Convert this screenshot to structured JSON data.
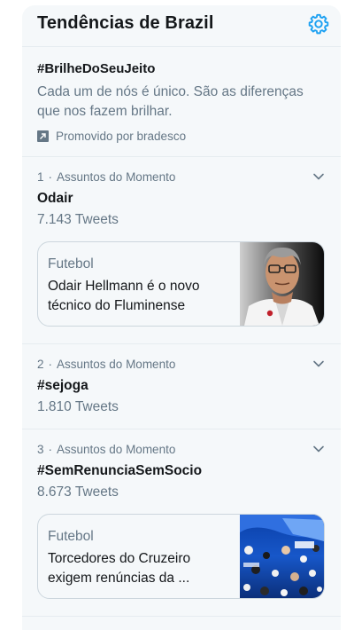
{
  "header": {
    "title": "Tendências de Brazil",
    "settings_icon": "gear-icon",
    "accent": "#1da1f2"
  },
  "promo": {
    "hashtag": "#BrilheDoSeuJeito",
    "description": "Cada um de nós é único. São as diferenças que nos fazem brilhar.",
    "promoted_by": "Promovido por bradesco",
    "icon": "promoted-arrow-icon"
  },
  "trends": [
    {
      "rank": "1",
      "separator": "·",
      "context": "Assuntos do Momento",
      "name": "Odair",
      "count": "7.143 Tweets",
      "card": {
        "category": "Futebol",
        "headline": "Odair Hellmann é o novo técnico do Fluminense"
      }
    },
    {
      "rank": "2",
      "separator": "·",
      "context": "Assuntos do Momento",
      "name": "#sejoga",
      "count": "1.810 Tweets"
    },
    {
      "rank": "3",
      "separator": "·",
      "context": "Assuntos do Momento",
      "name": "#SemRenunciaSemSocio",
      "count": "8.673 Tweets",
      "card": {
        "category": "Futebol",
        "headline": "Torcedores do Cruzeiro exigem renúncias da ..."
      }
    }
  ]
}
